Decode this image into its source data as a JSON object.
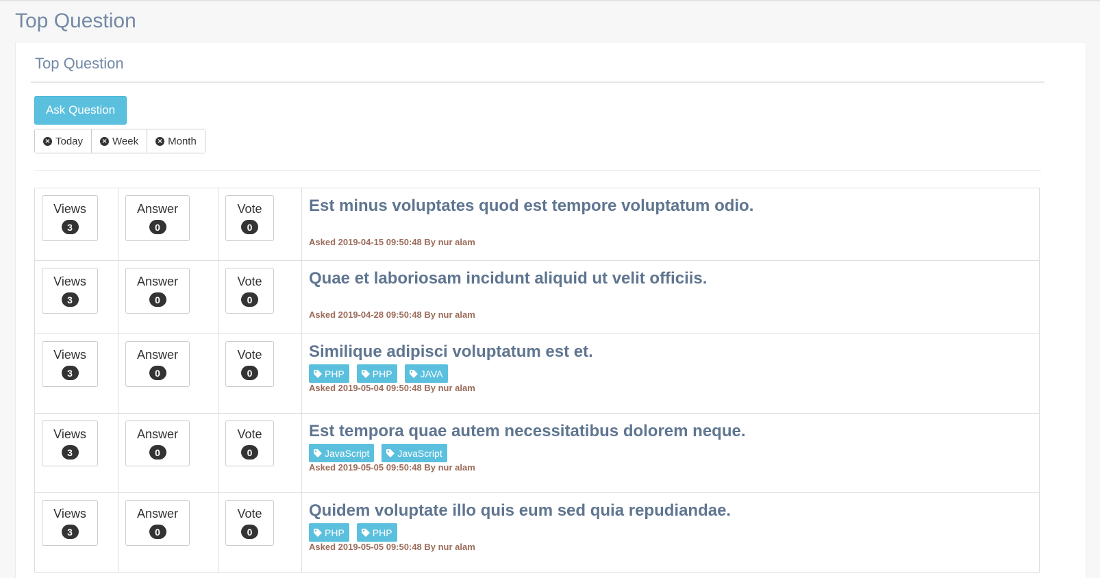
{
  "page": {
    "title": "Top Question"
  },
  "panel": {
    "title": "Top Question",
    "ask_button": "Ask Question"
  },
  "filters": [
    "Today",
    "Week",
    "Month"
  ],
  "stat_labels": {
    "views": "Views",
    "answer": "Answer",
    "vote": "Vote"
  },
  "questions": [
    {
      "views": "3",
      "answers": "0",
      "votes": "0",
      "title": "Est minus voluptates quod est tempore voluptatum odio.",
      "tags": [],
      "meta": "Asked 2019-04-15 09:50:48 By nur alam"
    },
    {
      "views": "3",
      "answers": "0",
      "votes": "0",
      "title": "Quae et laboriosam incidunt aliquid ut velit officiis.",
      "tags": [],
      "meta": "Asked 2019-04-28 09:50:48 By nur alam"
    },
    {
      "views": "3",
      "answers": "0",
      "votes": "0",
      "title": "Similique adipisci voluptatum est et.",
      "tags": [
        "PHP",
        "PHP",
        "JAVA"
      ],
      "meta": "Asked 2019-05-04 09:50:48 By nur alam"
    },
    {
      "views": "3",
      "answers": "0",
      "votes": "0",
      "title": "Est tempora quae autem necessitatibus dolorem neque.",
      "tags": [
        "JavaScript",
        "JavaScript"
      ],
      "meta": "Asked 2019-05-05 09:50:48 By nur alam"
    },
    {
      "views": "3",
      "answers": "0",
      "votes": "0",
      "title": "Quidem voluptate illo quis eum sed quia repudiandae.",
      "tags": [
        "PHP",
        "PHP"
      ],
      "meta": "Asked 2019-05-05 09:50:48 By nur alam"
    }
  ],
  "colors": {
    "accent": "#5bc0de",
    "title": "#5f7590",
    "meta": "#9b6b5a"
  }
}
